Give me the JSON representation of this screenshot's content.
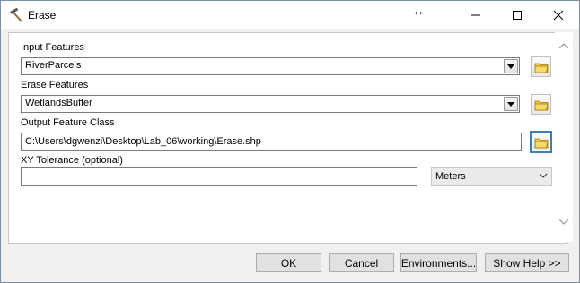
{
  "window": {
    "title": "Erase",
    "resize_glyph": "↔"
  },
  "caption_buttons": {
    "minimize": "minimize-icon",
    "maximize": "maximize-icon",
    "close": "close-icon"
  },
  "fields": {
    "input_features": {
      "label": "Input Features",
      "value": "RiverParcels"
    },
    "erase_features": {
      "label": "Erase Features",
      "value": "WetlandsBuffer"
    },
    "output_feature_class": {
      "label": "Output Feature Class",
      "value": "C:\\Users\\dgwenzi\\Desktop\\Lab_06\\working\\Erase.shp"
    },
    "xy_tolerance": {
      "label": "XY Tolerance (optional)",
      "value": "",
      "unit": "Meters"
    }
  },
  "buttons": {
    "ok": "OK",
    "cancel": "Cancel",
    "environments": "Environments...",
    "show_help": "Show Help >>"
  },
  "colors": {
    "focus_border": "#3c7fb1",
    "folder_yellow": "#f2c744"
  }
}
